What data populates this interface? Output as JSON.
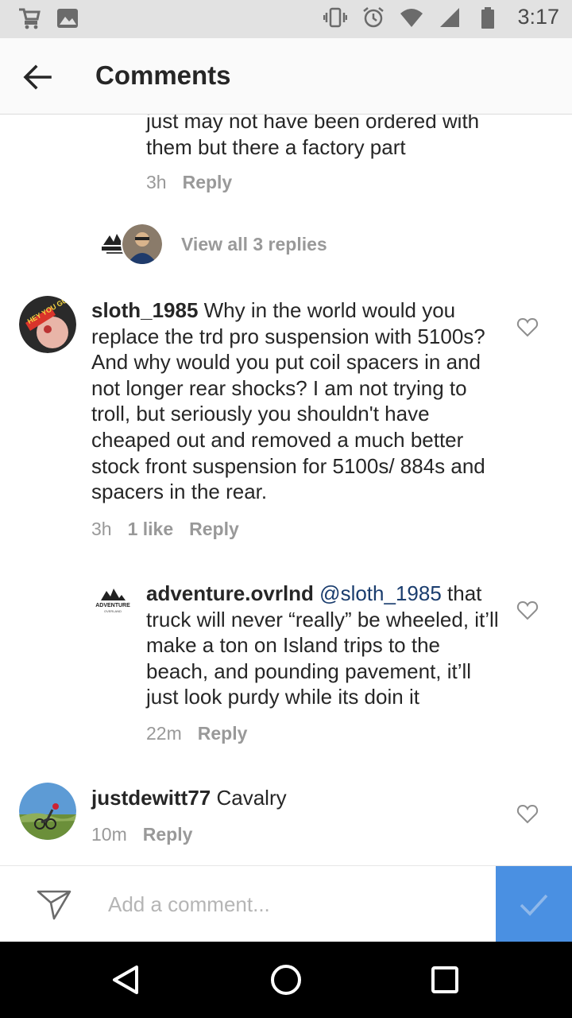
{
  "status_bar": {
    "time": "3:17",
    "left_icons": [
      "shopping-cart-notification-icon",
      "image-notification-icon"
    ],
    "right_icons": [
      "vibrate-icon",
      "alarm-icon",
      "wifi-icon",
      "cell-signal-icon",
      "battery-icon"
    ]
  },
  "header": {
    "title": "Comments",
    "back_icon": "arrow-left-icon"
  },
  "partial_comment": {
    "text": "just may not have been ordered with them but there a factory part",
    "time": "3h",
    "reply_label": "Reply"
  },
  "view_replies": {
    "label": "View all 3 replies"
  },
  "comments": [
    {
      "username": "sloth_1985",
      "text": "Why in the world would you replace the trd pro suspension with 5100s? And why would you put coil spacers in and not longer rear shocks? I am not trying to troll, but seriously you shouldn't have cheaped out and removed a much better stock front suspension for 5100s/ 884s and spacers in the rear.",
      "time": "3h",
      "likes": "1 like",
      "reply_label": "Reply",
      "avatar_text": "HEY YOU GUYS!"
    },
    {
      "username": "adventure.ovrlnd",
      "mention": "@sloth_1985",
      "text": "that truck will never “really” be wheeled, it’ll make a ton on Island trips to the beach, and pounding pavement, it’ll just look purdy while its doin it",
      "time": "22m",
      "reply_label": "Reply",
      "avatar_text": "ADVENTURE",
      "avatar_subtext": "OVERLAND"
    },
    {
      "username": "justdewitt77",
      "text": "Cavalry",
      "time": "10m",
      "reply_label": "Reply"
    }
  ],
  "composer": {
    "placeholder": "Add a comment...",
    "send_icon": "paper-plane-icon",
    "post_icon": "checkmark-icon"
  },
  "nav_bar": {
    "icons": [
      "back-triangle-icon",
      "home-circle-icon",
      "recents-square-icon"
    ]
  },
  "colors": {
    "accent": "#4a90e2",
    "muted_text": "#999999",
    "mention": "#1a3d6e"
  }
}
